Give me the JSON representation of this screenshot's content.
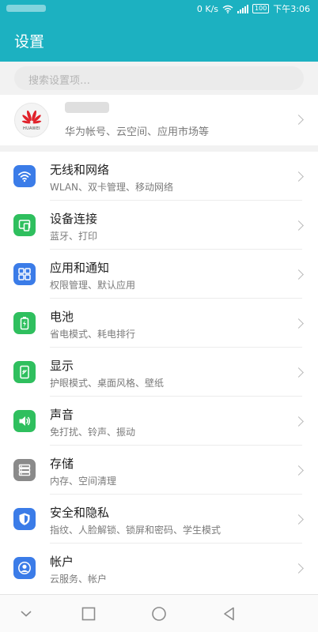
{
  "status": {
    "net_speed": "0 K/s",
    "battery": "100",
    "time": "下午3:06"
  },
  "header": {
    "title": "设置"
  },
  "search": {
    "placeholder": "搜索设置项…"
  },
  "account": {
    "brand": "HUAWEI",
    "subtitle": "华为帐号、云空间、应用市场等"
  },
  "settings": [
    {
      "title": "无线和网络",
      "subtitle": "WLAN、双卡管理、移动网络",
      "icon": "wifi-icon",
      "color": "#3b7ce8"
    },
    {
      "title": "设备连接",
      "subtitle": "蓝牙、打印",
      "icon": "device-connection-icon",
      "color": "#2fbf5e"
    },
    {
      "title": "应用和通知",
      "subtitle": "权限管理、默认应用",
      "icon": "apps-grid-icon",
      "color": "#3b7ce8"
    },
    {
      "title": "电池",
      "subtitle": "省电模式、耗电排行",
      "icon": "battery-icon",
      "color": "#2fbf5e"
    },
    {
      "title": "显示",
      "subtitle": "护眼模式、桌面风格、壁纸",
      "icon": "display-icon",
      "color": "#2fbf5e"
    },
    {
      "title": "声音",
      "subtitle": "免打扰、铃声、振动",
      "icon": "speaker-icon",
      "color": "#2fbf5e"
    },
    {
      "title": "存储",
      "subtitle": "内存、空间清理",
      "icon": "storage-icon",
      "color": "#8a8a8a"
    },
    {
      "title": "安全和隐私",
      "subtitle": "指纹、人脸解锁、锁屏和密码、学生模式",
      "icon": "shield-icon",
      "color": "#3b7ce8"
    },
    {
      "title": "帐户",
      "subtitle": "云服务、帐户",
      "icon": "account-icon",
      "color": "#3b7ce8"
    }
  ]
}
